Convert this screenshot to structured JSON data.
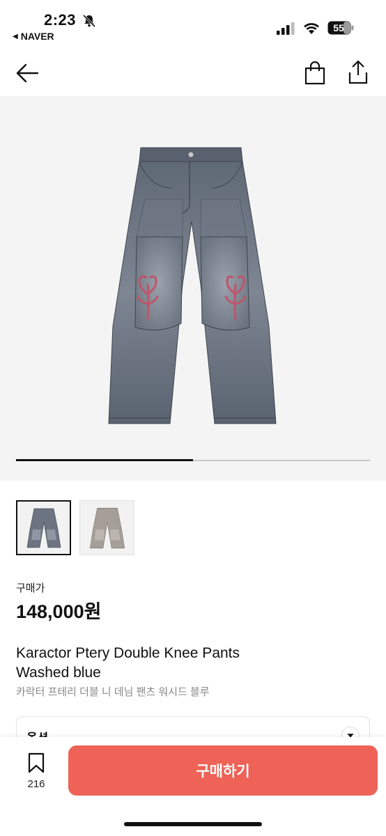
{
  "status": {
    "time": "2:23",
    "back_app": "NAVER",
    "battery": "55"
  },
  "product": {
    "gallery_position": 0.5,
    "price_label": "구매가",
    "price": "148,000원",
    "title_line1": "Karactor Ptery Double Knee Pants",
    "title_line2": "Washed blue",
    "subtitle": "카락터 프테리 더블 니 데님 팬츠 워시드 블루"
  },
  "options": {
    "label": "옵션"
  },
  "bottom": {
    "wish_count": "216",
    "buy_label": "구매하기"
  },
  "colors": {
    "accent": "#ee6257",
    "denim": "#6b7480",
    "embroidery": "#c0546a"
  },
  "icons": [
    "bell-off-icon",
    "signal-icon",
    "wifi-icon",
    "battery-icon",
    "back-arrow-icon",
    "shopping-bag-icon",
    "share-icon",
    "bookmark-icon",
    "chevron-down-icon"
  ]
}
